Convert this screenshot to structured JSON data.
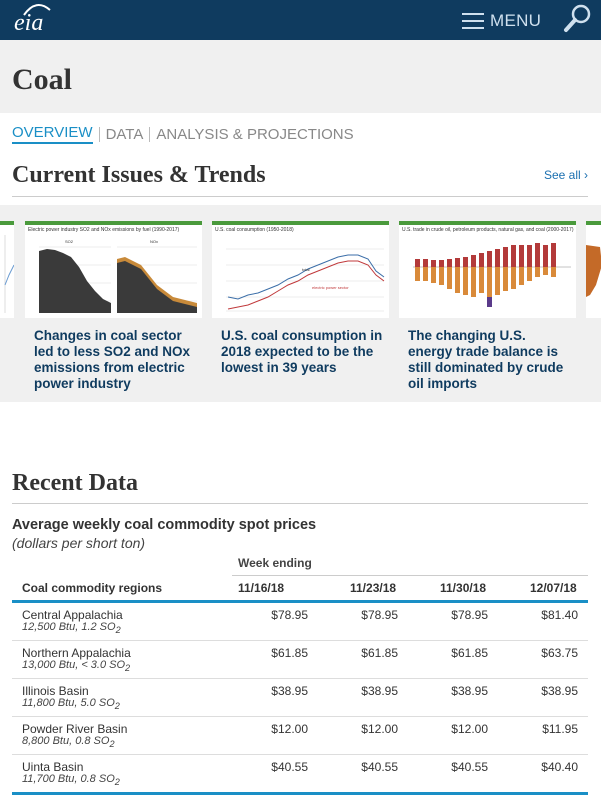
{
  "header": {
    "logo_text": "eia",
    "menu_label": "MENU"
  },
  "page": {
    "title": "Coal"
  },
  "tabs": [
    {
      "label": "OVERVIEW",
      "active": true
    },
    {
      "label": "DATA",
      "active": false
    },
    {
      "label": "ANALYSIS & PROJECTIONS",
      "active": false
    }
  ],
  "trends": {
    "title": "Current Issues & Trends",
    "see_all": "See all ›",
    "cards": [
      {
        "text": "Changes in coal sector led to less SO2 and NOx emissions from electric power industry",
        "thumb_title": "Electric power industry SO2 and NOx emissions by fuel (1990-2017)"
      },
      {
        "text": "U.S. coal consumption in 2018 expected to be the lowest in 39 years",
        "thumb_title": "U.S. coal consumption (1950-2018)"
      },
      {
        "text": "The changing U.S. energy trade balance is still dominated by crude oil imports",
        "thumb_title": "U.S. trade in crude oil, petroleum products, natural gas, and coal (2000-2017)"
      }
    ]
  },
  "recent": {
    "title": "Recent Data",
    "table_title": "Average weekly coal commodity spot prices",
    "table_subtitle": "(dollars per short ton)",
    "week_heading": "Week ending",
    "region_heading": "Coal commodity regions",
    "weeks": [
      "11/16/18",
      "11/23/18",
      "11/30/18",
      "12/07/18"
    ],
    "rows": [
      {
        "name": "Central Appalachia",
        "spec": "12,500 Btu, 1.2 SO",
        "spec_sub": "2",
        "values": [
          "$78.95",
          "$78.95",
          "$78.95",
          "$81.40"
        ]
      },
      {
        "name": "Northern Appalachia",
        "spec": "13,000 Btu, < 3.0 SO",
        "spec_sub": "2",
        "values": [
          "$61.85",
          "$61.85",
          "$61.85",
          "$63.75"
        ]
      },
      {
        "name": "Illinois Basin",
        "spec": "11,800 Btu, 5.0 SO",
        "spec_sub": "2",
        "values": [
          "$38.95",
          "$38.95",
          "$38.95",
          "$38.95"
        ]
      },
      {
        "name": "Powder River Basin",
        "spec": "8,800 Btu, 0.8 SO",
        "spec_sub": "2",
        "values": [
          "$12.00",
          "$12.00",
          "$12.00",
          "$11.95"
        ]
      },
      {
        "name": "Uinta Basin",
        "spec": "11,700 Btu, 0.8 SO",
        "spec_sub": "2",
        "values": [
          "$40.55",
          "$40.55",
          "$40.55",
          "$40.40"
        ]
      }
    ]
  },
  "colors": {
    "header_bg": "#0f3b5f",
    "accent": "#1a8fc6",
    "card_border": "#4a9a3c"
  },
  "icons": {
    "search": "magnifier-icon",
    "menu": "hamburger-icon"
  }
}
